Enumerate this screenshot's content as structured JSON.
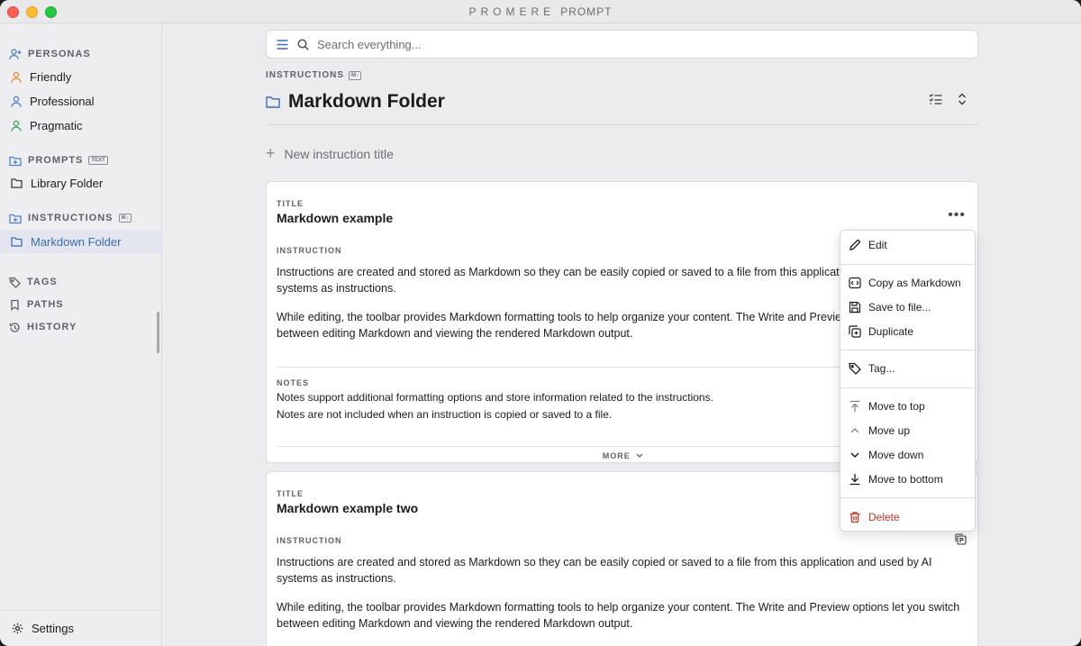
{
  "app": {
    "brand": "PROMERE",
    "title": "PROMPT"
  },
  "sidebar": {
    "personas_label": "PERSONAS",
    "personas": [
      {
        "label": "Friendly",
        "color": "#e8892b"
      },
      {
        "label": "Professional",
        "color": "#4a7fd0"
      },
      {
        "label": "Pragmatic",
        "color": "#3aa55a"
      }
    ],
    "prompts_label": "PROMPTS",
    "prompts_badge": "TEXT",
    "prompts_items": [
      "Library Folder"
    ],
    "instructions_label": "INSTRUCTIONS",
    "instructions_badge": "M↓",
    "instructions_items": [
      "Markdown Folder"
    ],
    "tags_label": "TAGS",
    "paths_label": "PATHS",
    "history_label": "HISTORY",
    "settings_label": "Settings"
  },
  "search": {
    "placeholder": "Search everything..."
  },
  "header": {
    "crumb": "INSTRUCTIONS",
    "crumb_badge": "M↓",
    "title": "Markdown Folder"
  },
  "new_instruction": {
    "placeholder": "New instruction title"
  },
  "cards": [
    {
      "title_label": "TITLE",
      "title": "Markdown example",
      "instruction_label": "INSTRUCTION",
      "para1": "Instructions are created and stored as Markdown so they can be easily copied or saved to a file from this application and used by AI systems as instructions.",
      "para2": "While editing, the toolbar provides Markdown formatting tools to help organize your content. The Write and Preview options let you switch between editing Markdown and viewing the rendered Markdown output.",
      "notes_label": "NOTES",
      "note1": "Notes support additional formatting options and store information related to the instructions.",
      "note2": "Notes are not included when an instruction is copied or saved to a file.",
      "more_label": "MORE"
    },
    {
      "title_label": "TITLE",
      "title": "Markdown example two",
      "instruction_label": "INSTRUCTION",
      "para1": "Instructions are created and stored as Markdown so they can be easily copied or saved to a file from this application and used by AI systems as instructions.",
      "para2": "While editing, the toolbar provides Markdown formatting tools to help organize your content. The Write and Preview options let you switch between editing Markdown and viewing the rendered Markdown output."
    }
  ],
  "menu": {
    "edit": "Edit",
    "copy_markdown": "Copy as Markdown",
    "save_file": "Save to file...",
    "duplicate": "Duplicate",
    "tag": "Tag...",
    "move_top": "Move to top",
    "move_up": "Move up",
    "move_down": "Move down",
    "move_bottom": "Move to bottom",
    "delete": "Delete"
  },
  "colors": {
    "accent": "#3a6db5",
    "danger": "#c4352a"
  }
}
